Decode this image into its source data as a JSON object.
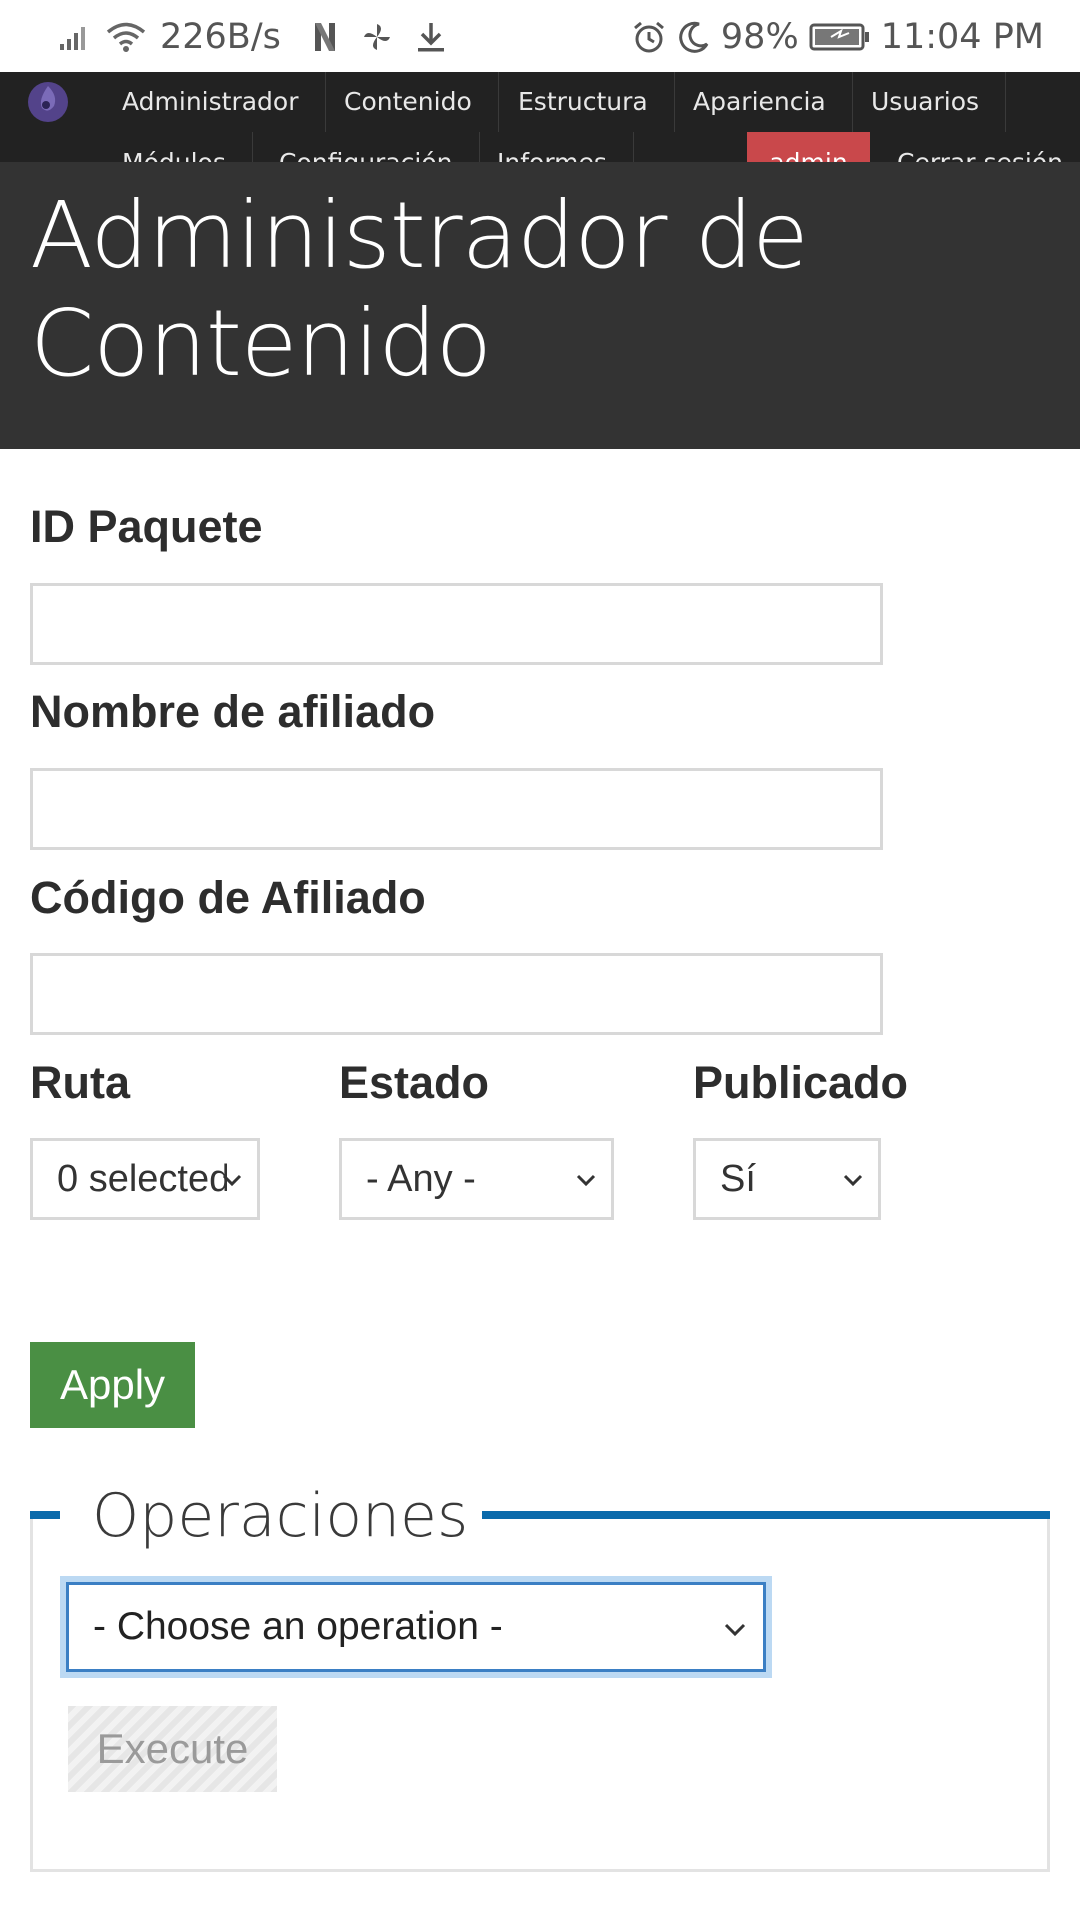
{
  "status_bar": {
    "speed": "226B/s",
    "battery": "98%",
    "time": "11:04 PM"
  },
  "toolbar": {
    "row1": [
      "Administrador",
      "Contenido",
      "Estructura",
      "Apariencia",
      "Usuarios"
    ],
    "row2": [
      "Módulos",
      "Configuración",
      "Informes"
    ],
    "user": "admin",
    "logout": "Cerrar sesión"
  },
  "header": {
    "title": "Administrador de Contenido"
  },
  "form": {
    "id_paquete_label": "ID Paquete",
    "id_paquete_value": "",
    "nombre_label": "Nombre de afiliado",
    "nombre_value": "",
    "codigo_label": "Código de Afiliado",
    "codigo_value": "",
    "ruta_label": "Ruta",
    "ruta_value": "0 selected",
    "estado_label": "Estado",
    "estado_value": "- Any -",
    "publicado_label": "Publicado",
    "publicado_value": "Sí",
    "apply_label": "Apply"
  },
  "operations": {
    "legend": "Operaciones",
    "select_value": "- Choose an operation -",
    "execute_label": "Execute"
  },
  "colors": {
    "toolbar_bg": "#222222",
    "header_bg": "#333333",
    "admin_badge": "#c9484b",
    "apply_button": "#4a8f44",
    "fieldset_accent": "#0a6aab",
    "focus_ring": "#bcd9f3"
  },
  "icons": [
    "signal-icon",
    "wifi-icon",
    "n-icon",
    "pinwheel-icon",
    "download-icon",
    "alarm-icon",
    "moon-icon",
    "battery-icon",
    "drupal-logo-icon",
    "chevron-down-icon"
  ]
}
